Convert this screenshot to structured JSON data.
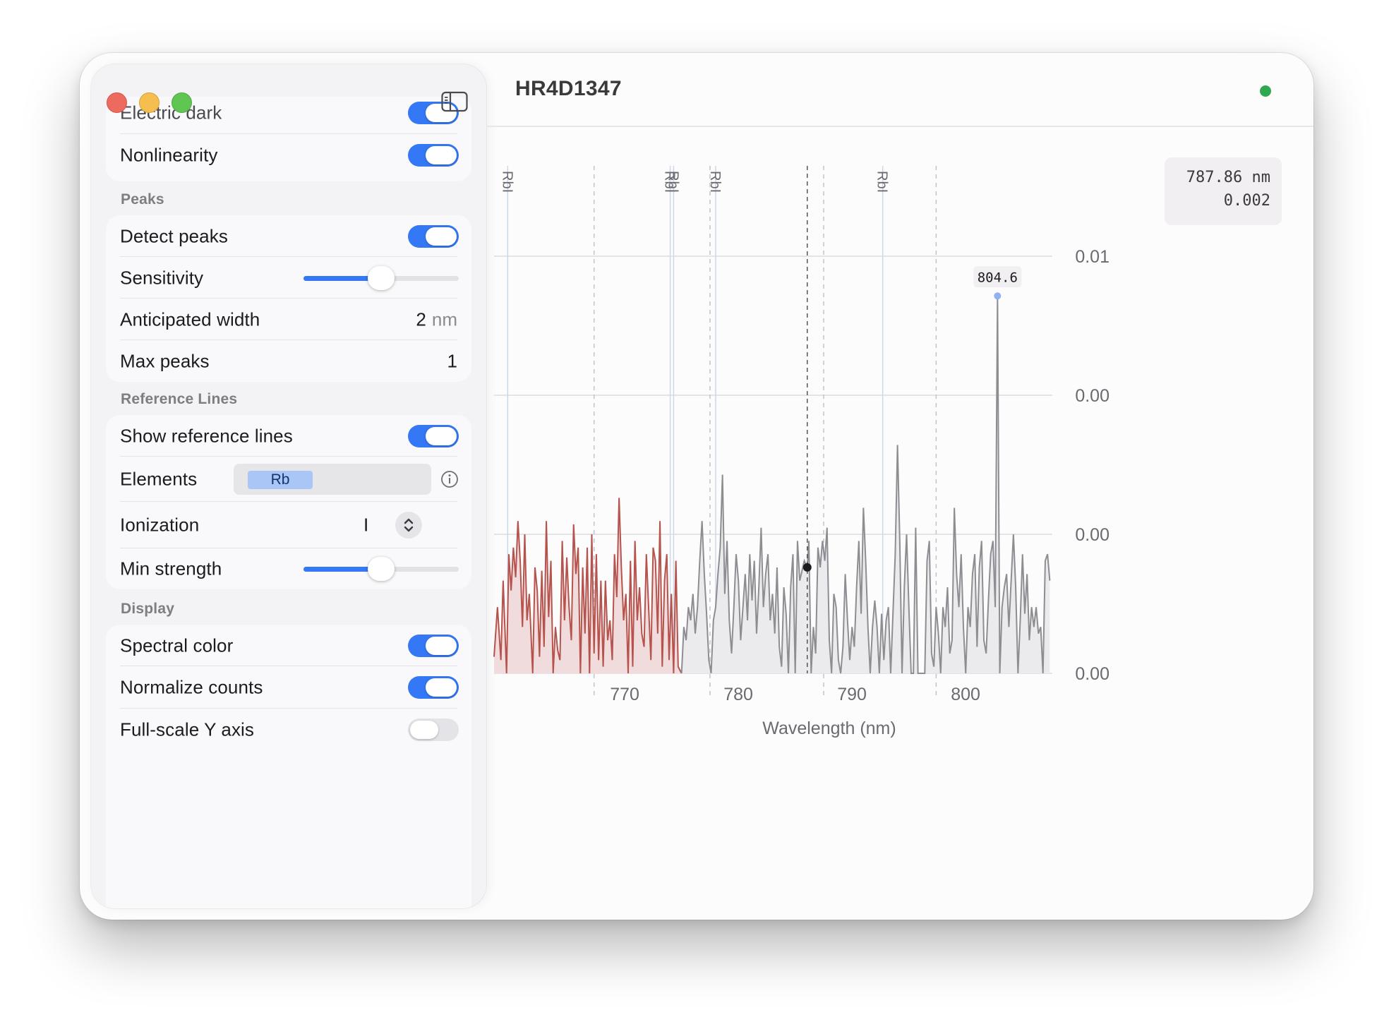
{
  "window": {
    "title": "HR4D1347"
  },
  "sidebar": {
    "calibration": {
      "electric_dark": {
        "label": "Electric dark",
        "on": true
      },
      "nonlinearity": {
        "label": "Nonlinearity",
        "on": true
      }
    },
    "peaks": {
      "header": "Peaks",
      "detect_peaks": {
        "label": "Detect peaks",
        "on": true
      },
      "sensitivity": {
        "label": "Sensitivity",
        "value": 0.5
      },
      "anticipated_width": {
        "label": "Anticipated width",
        "value": "2",
        "unit": "nm"
      },
      "max_peaks": {
        "label": "Max peaks",
        "value": "1"
      }
    },
    "reference_lines": {
      "header": "Reference Lines",
      "show": {
        "label": "Show reference lines",
        "on": true
      },
      "elements": {
        "label": "Elements",
        "tokens": [
          "Rb"
        ]
      },
      "ionization": {
        "label": "Ionization",
        "value": "I"
      },
      "min_strength": {
        "label": "Min strength",
        "value": 0.5
      }
    },
    "display": {
      "header": "Display",
      "spectral_color": {
        "label": "Spectral color",
        "on": true
      },
      "normalize_counts": {
        "label": "Normalize counts",
        "on": true
      },
      "full_scale_y": {
        "label": "Full-scale Y axis",
        "on": false
      }
    }
  },
  "cursor_readout": {
    "wavelength": "787.86 nm",
    "intensity": "0.002"
  },
  "icons": {
    "sidebar_toggle": "sidebar-toggle-icon",
    "info": "info-circle-icon",
    "stepper": "chevron-up-down-icon"
  },
  "colors": {
    "accent": "#3478f6",
    "status": "#2fa84f",
    "spectral_red": "#b5534c",
    "trace": "#8e8d92"
  },
  "chart_data": {
    "type": "area",
    "xlabel": "Wavelength (nm)",
    "ylabel": "",
    "xlim": [
      760.3,
      809.3
    ],
    "ylim": [
      0,
      0.0126
    ],
    "x_ticks": [
      770,
      780,
      790,
      800
    ],
    "y_ticks": [
      {
        "value": 0.0,
        "label": "0.00"
      },
      {
        "value": 0.0042,
        "label": "0.00"
      },
      {
        "value": 0.0084,
        "label": "0.00"
      },
      {
        "value": 0.0126,
        "label": "0.01"
      }
    ],
    "reference_lines": [
      {
        "element": "RbI",
        "wavelength": 761.5
      },
      {
        "element": "RbI",
        "wavelength": 775.8
      },
      {
        "element": "RbI",
        "wavelength": 776.1
      },
      {
        "element": "RbI",
        "wavelength": 779.8
      },
      {
        "element": "RbI",
        "wavelength": 794.5
      }
    ],
    "reference_label": "RbI",
    "peak": {
      "wavelength": 804.6,
      "value": 0.0114,
      "label": "804.6"
    },
    "cursor": {
      "wavelength": 787.86,
      "value": 0.0032
    },
    "dashed_x": [
      769.1,
      779.3,
      789.3,
      799.2
    ],
    "spectral_cutoff": 776.8,
    "series": [
      {
        "values": [
          [
            760.3,
            0.0005
          ],
          [
            760.6,
            0.002
          ],
          [
            760.9,
            0.0004
          ],
          [
            761.1,
            0.0028
          ],
          [
            761.4,
            0.0
          ],
          [
            761.6,
            0.0036
          ],
          [
            761.8,
            0.0025
          ],
          [
            762.0,
            0.0038
          ],
          [
            762.2,
            0.0029
          ],
          [
            762.4,
            0.0046
          ],
          [
            762.6,
            0.0034
          ],
          [
            762.8,
            0.0014
          ],
          [
            763.0,
            0.0042
          ],
          [
            763.2,
            0.0016
          ],
          [
            763.4,
            0.0024
          ],
          [
            763.7,
            0.0
          ],
          [
            763.9,
            0.0032
          ],
          [
            764.1,
            0.0025
          ],
          [
            764.3,
            0.0005
          ],
          [
            764.5,
            0.0031
          ],
          [
            764.7,
            0.0008
          ],
          [
            764.9,
            0.0046
          ],
          [
            765.1,
            0.0017
          ],
          [
            765.3,
            0.0034
          ],
          [
            765.5,
            0.0
          ],
          [
            765.7,
            0.0014
          ],
          [
            765.9,
            0.0007
          ],
          [
            766.1,
            0.0004
          ],
          [
            766.3,
            0.004
          ],
          [
            766.5,
            0.0016
          ],
          [
            766.7,
            0.0035
          ],
          [
            766.9,
            0.002
          ],
          [
            767.1,
            0.001
          ],
          [
            767.3,
            0.0045
          ],
          [
            767.5,
            0.003
          ],
          [
            767.7,
            0.0038
          ],
          [
            767.9,
            0.0
          ],
          [
            768.1,
            0.0032
          ],
          [
            768.3,
            0.0012
          ],
          [
            768.5,
            0.0038
          ],
          [
            768.7,
            0.0
          ],
          [
            768.9,
            0.0042
          ],
          [
            769.1,
            0.0006
          ],
          [
            769.3,
            0.0036
          ],
          [
            769.5,
            0.0004
          ],
          [
            769.7,
            0.0028
          ],
          [
            769.9,
            0.0002
          ],
          [
            770.1,
            0.0028
          ],
          [
            770.3,
            0.001
          ],
          [
            770.5,
            0.0016
          ],
          [
            770.7,
            0.0004
          ],
          [
            770.9,
            0.0036
          ],
          [
            771.1,
            0.0023
          ],
          [
            771.3,
            0.0053
          ],
          [
            771.5,
            0.0032
          ],
          [
            771.7,
            0.0016
          ],
          [
            771.9,
            0.0024
          ],
          [
            772.1,
            0.0
          ],
          [
            772.3,
            0.0034
          ],
          [
            772.5,
            0.0002
          ],
          [
            772.7,
            0.004
          ],
          [
            772.9,
            0.0016
          ],
          [
            773.1,
            0.0026
          ],
          [
            773.3,
            0.0012
          ],
          [
            773.5,
            0.0008
          ],
          [
            773.7,
            0.0036
          ],
          [
            773.9,
            0.002
          ],
          [
            774.1,
            0.0004
          ],
          [
            774.3,
            0.0038
          ],
          [
            774.5,
            0.0034
          ],
          [
            774.7,
            0.0012
          ],
          [
            774.9,
            0.0046
          ],
          [
            775.1,
            0.0002
          ],
          [
            775.3,
            0.0028
          ],
          [
            775.5,
            0.0036
          ],
          [
            775.7,
            0.0004
          ],
          [
            775.9,
            0.0024
          ],
          [
            776.1,
            0.0
          ],
          [
            776.3,
            0.0034
          ],
          [
            776.5,
            0.0002
          ],
          [
            776.8,
            0.0
          ],
          [
            777.0,
            0.0014
          ],
          [
            777.2,
            0.001
          ],
          [
            777.4,
            0.002
          ],
          [
            777.6,
            0.0016
          ],
          [
            777.8,
            0.0024
          ],
          [
            778.0,
            0.0012
          ],
          [
            778.2,
            0.002
          ],
          [
            778.4,
            0.0034
          ],
          [
            778.6,
            0.0046
          ],
          [
            778.8,
            0.003
          ],
          [
            779.0,
            0.0018
          ],
          [
            779.2,
            0.0004
          ],
          [
            779.4,
            0.0
          ],
          [
            779.6,
            0.0016
          ],
          [
            779.8,
            0.002
          ],
          [
            780.0,
            0.003
          ],
          [
            780.2,
            0.0038
          ],
          [
            780.4,
            0.006
          ],
          [
            780.6,
            0.0024
          ],
          [
            780.8,
            0.004
          ],
          [
            781.0,
            0.0016
          ],
          [
            781.2,
            0.0006
          ],
          [
            781.4,
            0.002
          ],
          [
            781.6,
            0.0036
          ],
          [
            781.8,
            0.0028
          ],
          [
            782.0,
            0.001
          ],
          [
            782.2,
            0.002
          ],
          [
            782.4,
            0.003
          ],
          [
            782.6,
            0.0016
          ],
          [
            782.8,
            0.0036
          ],
          [
            783.0,
            0.0022
          ],
          [
            783.2,
            0.0034
          ],
          [
            783.4,
            0.0012
          ],
          [
            783.6,
            0.0026
          ],
          [
            783.8,
            0.0044
          ],
          [
            784.0,
            0.002
          ],
          [
            784.2,
            0.003
          ],
          [
            784.4,
            0.0036
          ],
          [
            784.6,
            0.0016
          ],
          [
            784.8,
            0.0024
          ],
          [
            785.0,
            0.0012
          ],
          [
            785.2,
            0.0032
          ],
          [
            785.4,
            0.0008
          ],
          [
            785.6,
            0.0002
          ],
          [
            785.8,
            0.0026
          ],
          [
            786.0,
            0.0018
          ],
          [
            786.2,
            0.0
          ],
          [
            786.4,
            0.0026
          ],
          [
            786.6,
            0.0036
          ],
          [
            786.8,
            0.0
          ],
          [
            787.0,
            0.004
          ],
          [
            787.2,
            0.0028
          ],
          [
            787.6,
            0.0034
          ],
          [
            787.86,
            0.0032
          ],
          [
            788.0,
            0.004
          ],
          [
            788.2,
            0.0
          ],
          [
            788.4,
            0.0014
          ],
          [
            788.6,
            0.0006
          ],
          [
            788.8,
            0.0038
          ],
          [
            789.0,
            0.0032
          ],
          [
            789.2,
            0.004
          ],
          [
            789.4,
            0.0034
          ],
          [
            789.6,
            0.0044
          ],
          [
            789.8,
            0.001
          ],
          [
            790.0,
            0.0
          ],
          [
            790.2,
            0.0024
          ],
          [
            790.4,
            0.002
          ],
          [
            790.6,
            0.0004
          ],
          [
            790.8,
            0.0
          ],
          [
            791.0,
            0.0008
          ],
          [
            791.2,
            0.003
          ],
          [
            791.4,
            0.0016
          ],
          [
            791.6,
            0.0004
          ],
          [
            791.8,
            0.0014
          ],
          [
            792.0,
            0.0008
          ],
          [
            792.2,
            0.0026
          ],
          [
            792.4,
            0.004
          ],
          [
            792.6,
            0.0018
          ],
          [
            792.8,
            0.005
          ],
          [
            793.0,
            0.0034
          ],
          [
            793.2,
            0.0014
          ],
          [
            793.4,
            0.0
          ],
          [
            793.6,
            0.0014
          ],
          [
            793.8,
            0.0022
          ],
          [
            794.0,
            0.0014
          ],
          [
            794.2,
            0.0
          ],
          [
            794.4,
            0.0018
          ],
          [
            794.6,
            0.0004
          ],
          [
            794.8,
            0.0016
          ],
          [
            795.0,
            0.002
          ],
          [
            795.2,
            0.0
          ],
          [
            795.4,
            0.0018
          ],
          [
            795.6,
            0.0036
          ],
          [
            795.8,
            0.0069
          ],
          [
            796.0,
            0.004
          ],
          [
            796.2,
            0.0
          ],
          [
            796.4,
            0.0026
          ],
          [
            796.6,
            0.0042
          ],
          [
            796.8,
            0.002
          ],
          [
            797.0,
            0.0
          ],
          [
            797.2,
            0.0
          ],
          [
            797.4,
            0.0044
          ],
          [
            797.6,
            0.0
          ],
          [
            797.8,
            0.0
          ],
          [
            798.0,
            0.0
          ],
          [
            798.2,
            0.0
          ],
          [
            798.4,
            0.0034
          ],
          [
            798.6,
            0.004
          ],
          [
            798.8,
            0.0006
          ],
          [
            799.0,
            0.0002
          ],
          [
            799.2,
            0.002
          ],
          [
            799.4,
            0.0012
          ],
          [
            799.6,
            0.0
          ],
          [
            799.8,
            0.002
          ],
          [
            800.0,
            0.0014
          ],
          [
            800.2,
            0.0026
          ],
          [
            800.4,
            0.0006
          ],
          [
            800.6,
            0.001
          ],
          [
            800.8,
            0.005
          ],
          [
            801.0,
            0.003
          ],
          [
            801.2,
            0.002
          ],
          [
            801.4,
            0.0036
          ],
          [
            801.6,
            0.0014
          ],
          [
            801.8,
            0.0
          ],
          [
            802.0,
            0.002
          ],
          [
            802.2,
            0.0014
          ],
          [
            802.4,
            0.003
          ],
          [
            802.6,
            0.0036
          ],
          [
            802.8,
            0.0008
          ],
          [
            803.0,
            0.0032
          ],
          [
            803.2,
            0.004
          ],
          [
            803.4,
            0.001
          ],
          [
            803.6,
            0.0006
          ],
          [
            803.8,
            0.0022
          ],
          [
            804.0,
            0.0036
          ],
          [
            804.2,
            0.004
          ],
          [
            804.4,
            0.002
          ],
          [
            804.6,
            0.0114
          ],
          [
            804.8,
            0.0
          ],
          [
            805.0,
            0.002
          ],
          [
            805.2,
            0.0026
          ],
          [
            805.4,
            0.003
          ],
          [
            805.6,
            0.0014
          ],
          [
            805.8,
            0.0028
          ],
          [
            806.0,
            0.0042
          ],
          [
            806.2,
            0.0026
          ],
          [
            806.4,
            0.0
          ],
          [
            806.6,
            0.0016
          ],
          [
            806.8,
            0.0036
          ],
          [
            807.0,
            0.0018
          ],
          [
            807.2,
            0.003
          ],
          [
            807.4,
            0.001
          ],
          [
            807.6,
            0.002
          ],
          [
            807.8,
            0.0014
          ],
          [
            808.0,
            0.002
          ],
          [
            808.2,
            0.0012
          ],
          [
            808.4,
            0.0014
          ],
          [
            808.6,
            0.0
          ],
          [
            808.8,
            0.0034
          ],
          [
            809.0,
            0.0036
          ],
          [
            809.2,
            0.0028
          ]
        ]
      }
    ]
  }
}
